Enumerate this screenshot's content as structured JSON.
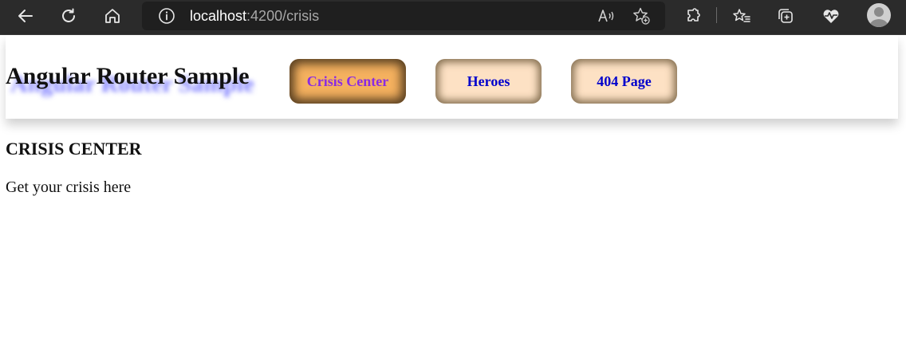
{
  "browser": {
    "url_host": "localhost",
    "url_path": ":4200/crisis",
    "icons": [
      "back-icon",
      "refresh-icon",
      "home-icon",
      "info-icon",
      "read-aloud-icon",
      "add-favorite-icon",
      "extensions-icon",
      "favorites-icon",
      "collections-icon",
      "performance-icon",
      "profile-icon"
    ]
  },
  "header": {
    "title": "Angular Router Sample",
    "nav": [
      {
        "label": "Crisis Center",
        "active": true
      },
      {
        "label": "Heroes",
        "active": false
      },
      {
        "label": "404 Page",
        "active": false
      }
    ]
  },
  "main": {
    "heading": "CRISIS CENTER",
    "text": "Get your crisis here"
  },
  "colors": {
    "active_button": "#f5b15f",
    "inactive_button": "#fde1c4",
    "active_link_text": "#8a2be2",
    "link_text": "#0000cc",
    "title_shadow": "#5050ff"
  }
}
